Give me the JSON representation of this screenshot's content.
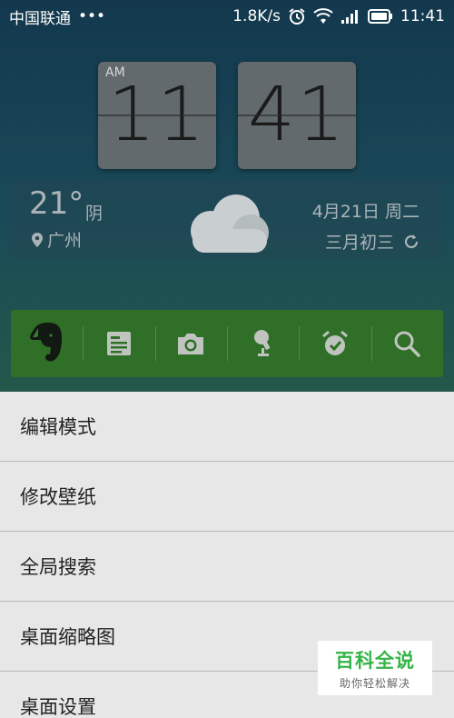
{
  "status_bar": {
    "carrier": "中国联通",
    "dots": "•••",
    "net_speed": "1.8K/s",
    "time": "11:41",
    "icons": [
      "alarm-icon",
      "wifi-icon",
      "signal-icon",
      "battery-icon"
    ]
  },
  "clock": {
    "ampm": "AM",
    "hour": "11",
    "minute": "41"
  },
  "weather": {
    "temperature": "21°",
    "condition": "阴",
    "location": "广州",
    "date": "4月21日 周二",
    "lunar": "三月初三",
    "icon": "cloud-icon"
  },
  "dock": {
    "items": [
      {
        "name": "evernote-icon"
      },
      {
        "name": "note-icon"
      },
      {
        "name": "camera-icon"
      },
      {
        "name": "voice-recorder-icon"
      },
      {
        "name": "alarm-clock-icon"
      },
      {
        "name": "search-icon"
      }
    ]
  },
  "menu": {
    "items": [
      {
        "label": "编辑模式"
      },
      {
        "label": "修改壁纸"
      },
      {
        "label": "全局搜索"
      },
      {
        "label": "桌面缩略图"
      },
      {
        "label": "桌面设置"
      }
    ]
  },
  "watermark": {
    "title": "百科全说",
    "subtitle": "助你轻松解决"
  },
  "colors": {
    "dock_green": "#2f6f27",
    "menu_bg": "#e7e7e7",
    "watermark_green": "#35b447"
  }
}
